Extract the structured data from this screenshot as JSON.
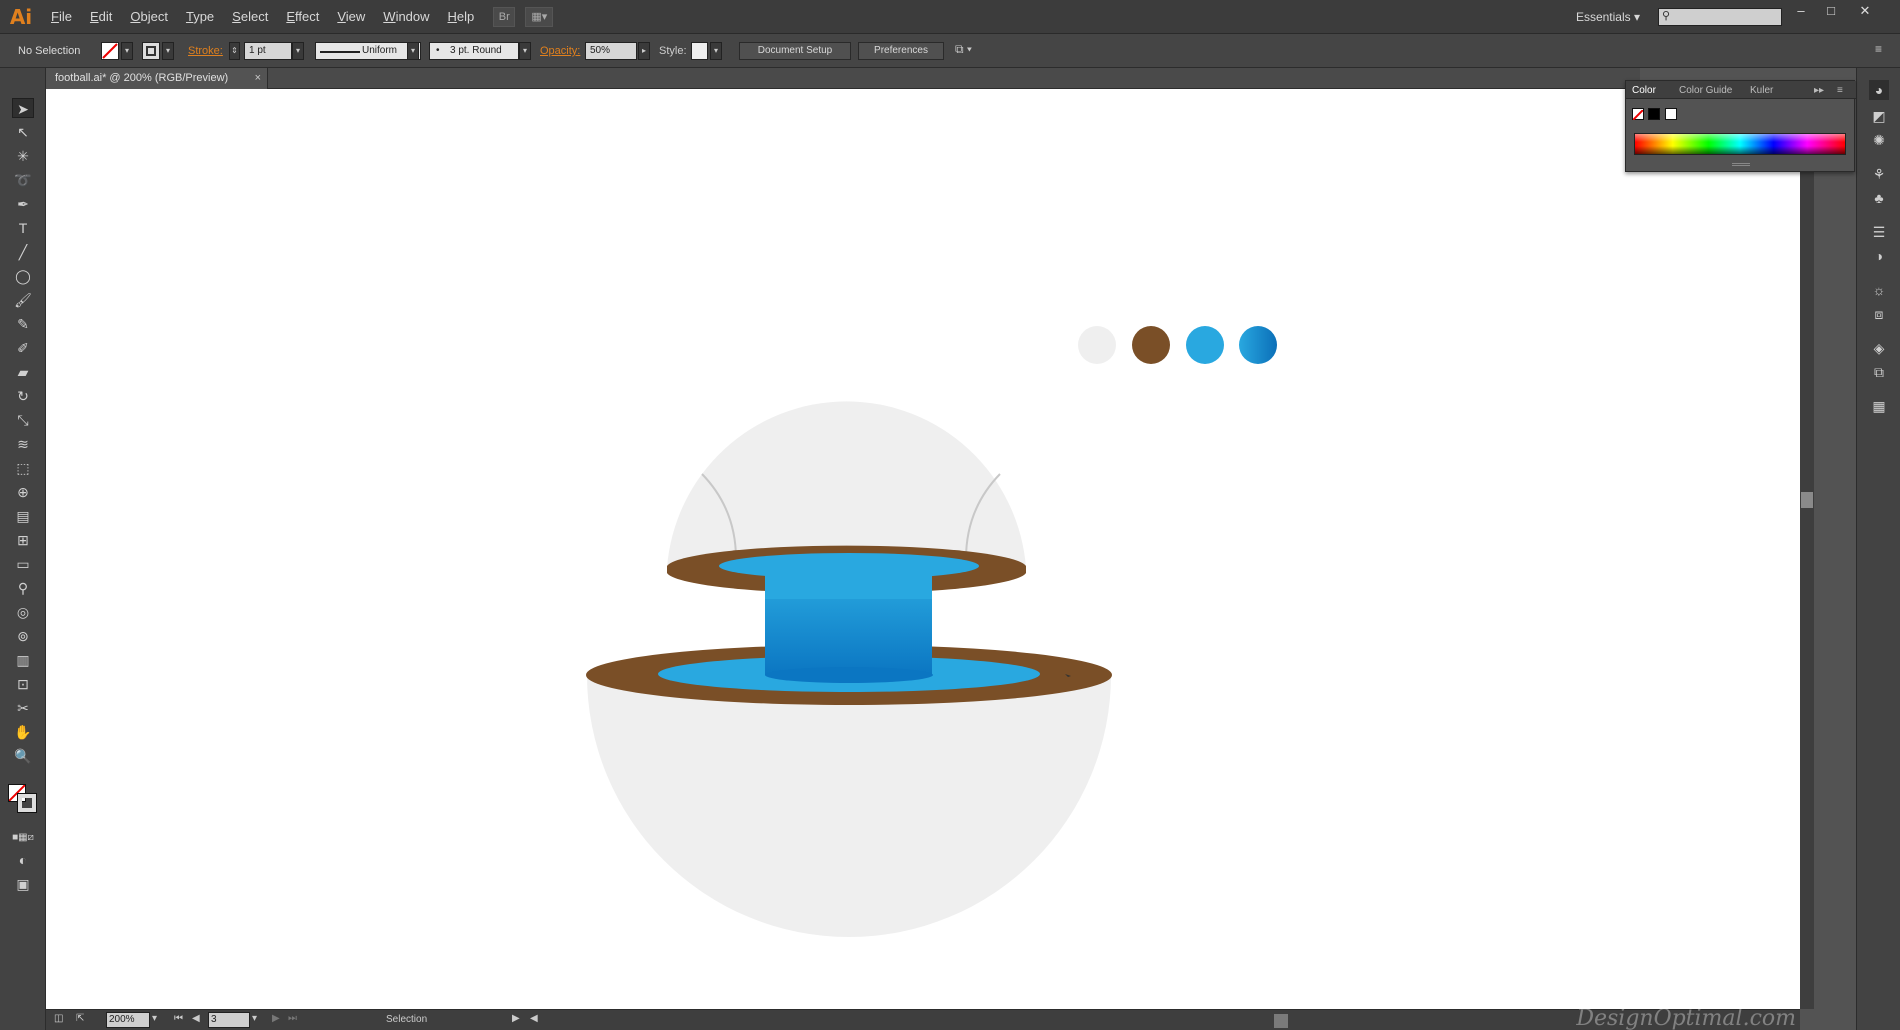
{
  "app": {
    "logo": "Ai"
  },
  "menu": [
    "File",
    "Edit",
    "Object",
    "Type",
    "Select",
    "Effect",
    "View",
    "Window",
    "Help"
  ],
  "workspace": "Essentials",
  "control_bar": {
    "selection": "No Selection",
    "stroke_label": "Stroke:",
    "stroke_weight": "1 pt",
    "profile": "Uniform",
    "brush": "3 pt. Round",
    "opacity_label": "Opacity:",
    "opacity_value": "50%",
    "style_label": "Style:",
    "document_setup": "Document Setup",
    "preferences": "Preferences"
  },
  "document": {
    "tab_title": "football.ai* @ 200% (RGB/Preview)"
  },
  "status_bar": {
    "zoom": "200%",
    "artboard": "3",
    "tool": "Selection",
    "watermark": "DesignOptimal.com"
  },
  "color_panel": {
    "tabs": [
      "Color",
      "Color Guide",
      "Kuler"
    ]
  },
  "colors": {
    "light_gray": "#efefef",
    "brown": "#7a4f27",
    "blue": "#29a8e0",
    "blue_dark": "#0b76c2",
    "accent": "#e0801e"
  },
  "swatch_dots": [
    "#efefef",
    "#7a4f27",
    "#29a8e0",
    "gradient"
  ]
}
